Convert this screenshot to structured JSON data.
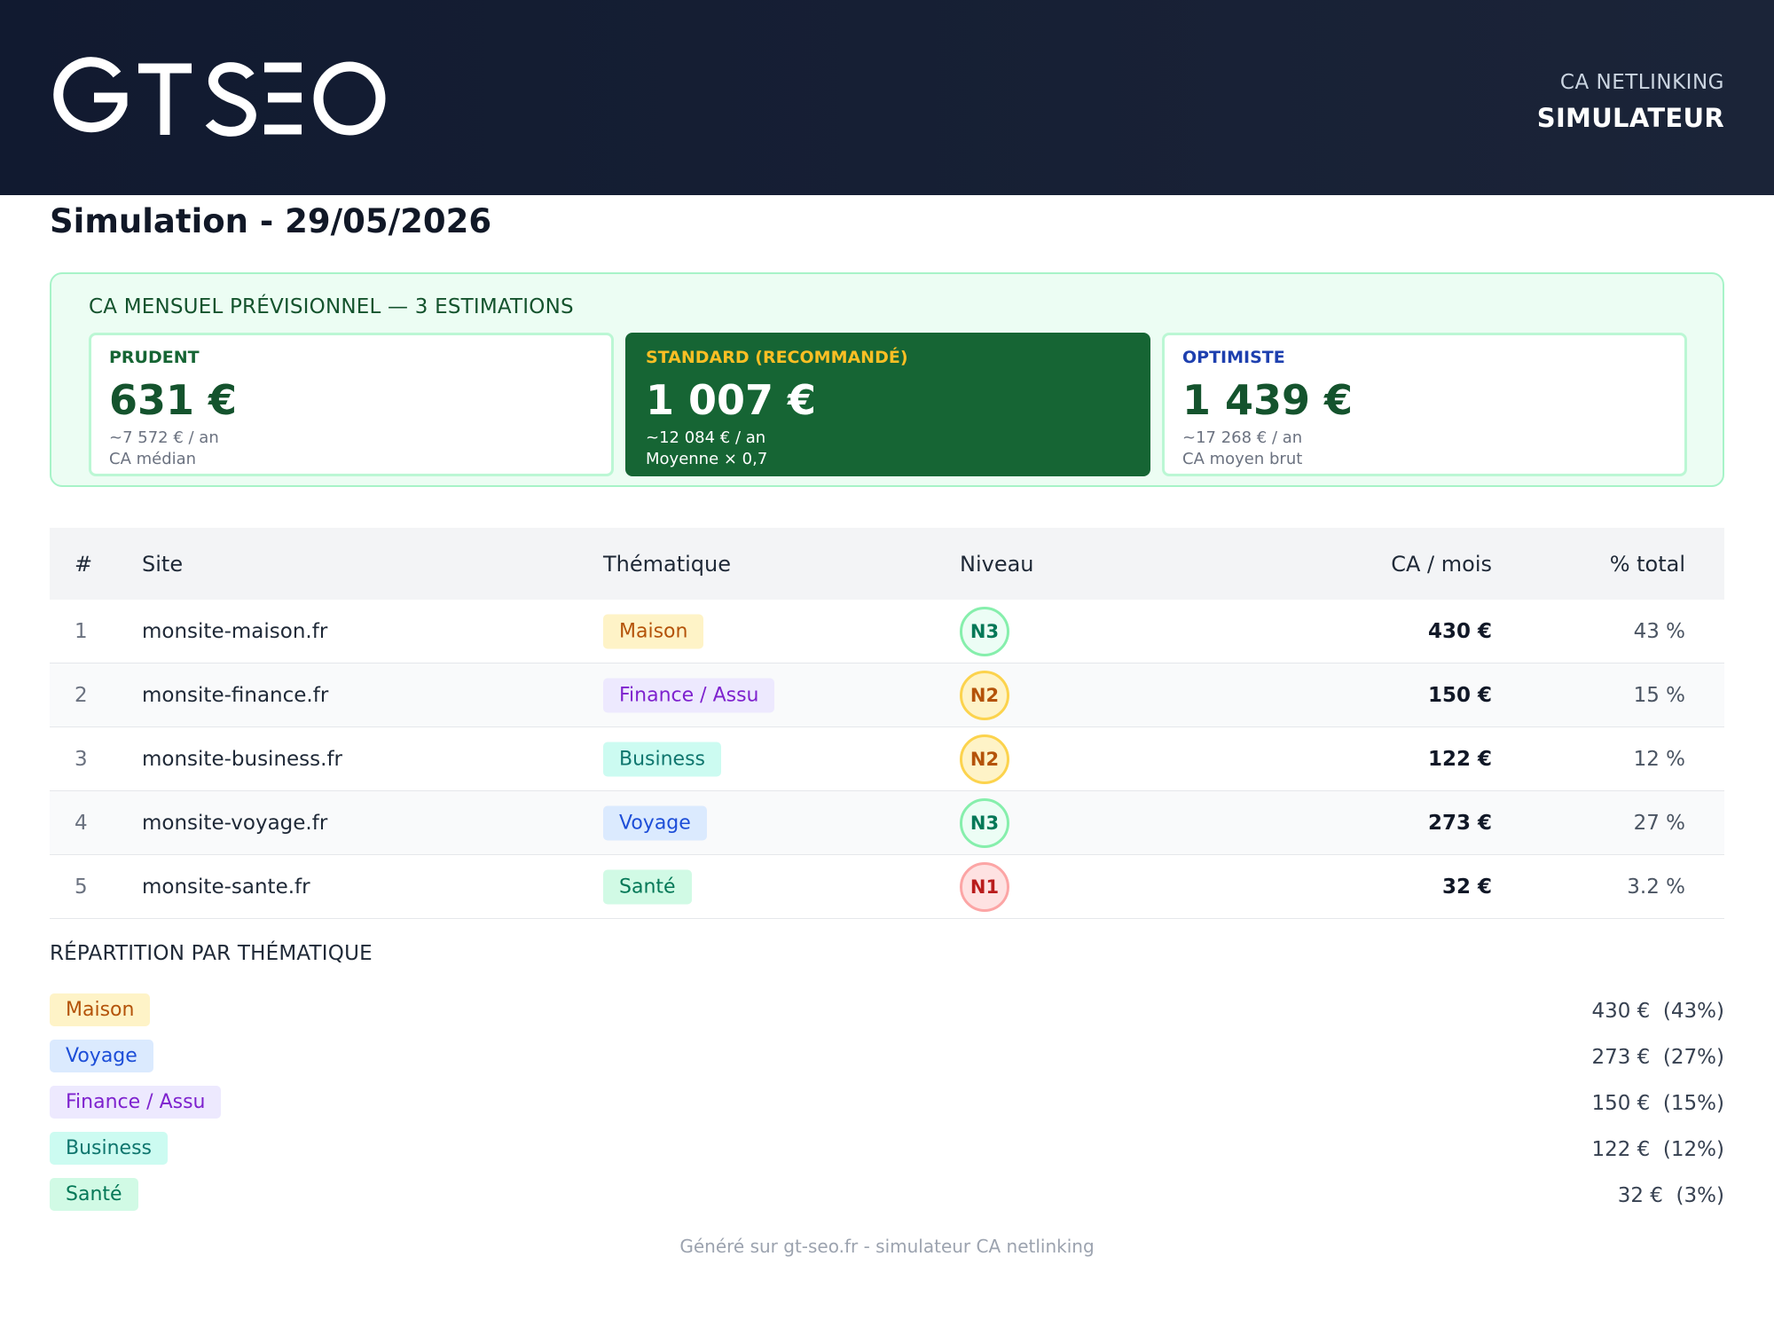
{
  "header": {
    "logo_text": "GT SEO",
    "brand_sub": "CA NETLINKING",
    "brand_main": "SIMULATEUR"
  },
  "page_title": "Simulation - 29/05/2026",
  "estimates": {
    "heading": "CA MENSUEL PRÉVISIONNEL — 3 ESTIMATIONS",
    "cards": [
      {
        "label": "PRUDENT",
        "value": "631 €",
        "annual": "~7 572 € / an",
        "basis": "CA médian"
      },
      {
        "label": "STANDARD (RECOMMANDÉ)",
        "value": "1 007 €",
        "annual": "~12 084 € / an",
        "basis": "Moyenne × 0,7"
      },
      {
        "label": "OPTIMISTE",
        "value": "1 439 €",
        "annual": "~17 268 € / an",
        "basis": "CA moyen brut"
      }
    ]
  },
  "table": {
    "headers": {
      "num": "#",
      "site": "Site",
      "theme": "Thématique",
      "level": "Niveau",
      "ca": "CA / mois",
      "pct": "% total"
    },
    "rows": [
      {
        "num": "1",
        "site": "monsite-maison.fr",
        "theme": "Maison",
        "level": "N3",
        "ca": "430 €",
        "pct": "43 %"
      },
      {
        "num": "2",
        "site": "monsite-finance.fr",
        "theme": "Finance / Assu",
        "level": "N2",
        "ca": "150 €",
        "pct": "15 %"
      },
      {
        "num": "3",
        "site": "monsite-business.fr",
        "theme": "Business",
        "level": "N2",
        "ca": "122 €",
        "pct": "12 %"
      },
      {
        "num": "4",
        "site": "monsite-voyage.fr",
        "theme": "Voyage",
        "level": "N3",
        "ca": "273 €",
        "pct": "27 %"
      },
      {
        "num": "5",
        "site": "monsite-sante.fr",
        "theme": "Santé",
        "level": "N1",
        "ca": "32 €",
        "pct": "3.2 %"
      }
    ]
  },
  "repartition": {
    "title": "RÉPARTITION PAR THÉMATIQUE",
    "items": [
      {
        "theme": "Maison",
        "amount": "430 €  (43%)"
      },
      {
        "theme": "Voyage",
        "amount": "273 €  (27%)"
      },
      {
        "theme": "Finance / Assu",
        "amount": "150 €  (15%)"
      },
      {
        "theme": "Business",
        "amount": "122 €  (12%)"
      },
      {
        "theme": "Santé",
        "amount": "32 €  (3%)"
      }
    ]
  },
  "footer": "Généré sur gt-seo.fr - simulateur CA netlinking",
  "colors": {
    "header_bg": "#111a30",
    "accent_green": "#166534",
    "accent_gold": "#fbbf24",
    "accent_blue": "#1e40af"
  }
}
